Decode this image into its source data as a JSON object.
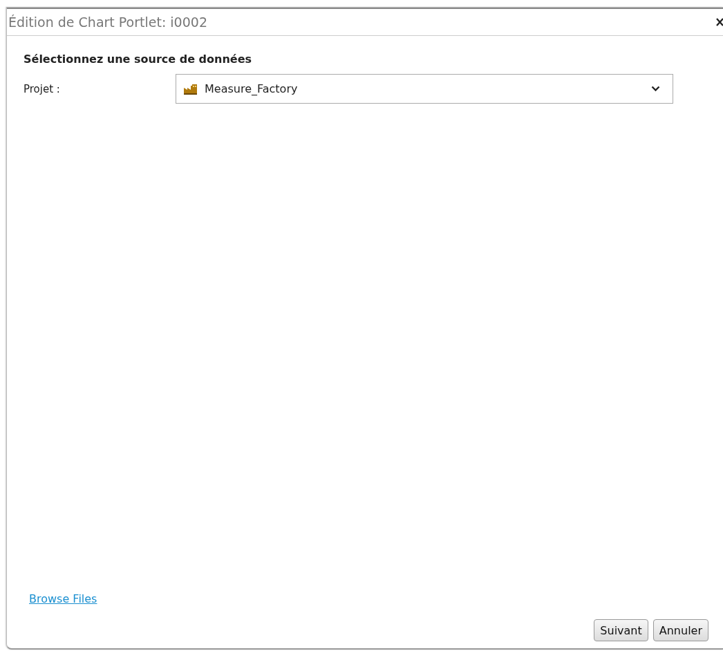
{
  "window": {
    "title": "Édition de Chart Portlet: i0002"
  },
  "heading": "Sélectionnez une source de données",
  "project": {
    "label": "Projet :",
    "value": "Measure_Factory"
  },
  "link": "Browse Files",
  "buttons": [
    "Suivant",
    "Annuler"
  ]
}
